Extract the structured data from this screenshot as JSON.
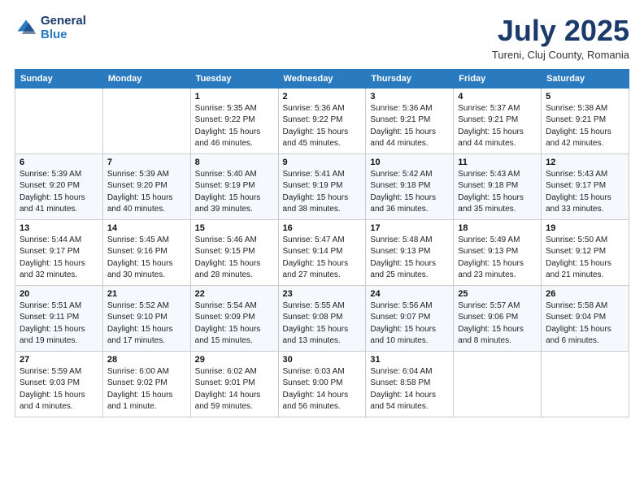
{
  "logo": {
    "general": "General",
    "blue": "Blue"
  },
  "title": "July 2025",
  "location": "Tureni, Cluj County, Romania",
  "headers": [
    "Sunday",
    "Monday",
    "Tuesday",
    "Wednesday",
    "Thursday",
    "Friday",
    "Saturday"
  ],
  "weeks": [
    [
      {
        "day": "",
        "info": ""
      },
      {
        "day": "",
        "info": ""
      },
      {
        "day": "1",
        "info": "Sunrise: 5:35 AM\nSunset: 9:22 PM\nDaylight: 15 hours\nand 46 minutes."
      },
      {
        "day": "2",
        "info": "Sunrise: 5:36 AM\nSunset: 9:22 PM\nDaylight: 15 hours\nand 45 minutes."
      },
      {
        "day": "3",
        "info": "Sunrise: 5:36 AM\nSunset: 9:21 PM\nDaylight: 15 hours\nand 44 minutes."
      },
      {
        "day": "4",
        "info": "Sunrise: 5:37 AM\nSunset: 9:21 PM\nDaylight: 15 hours\nand 44 minutes."
      },
      {
        "day": "5",
        "info": "Sunrise: 5:38 AM\nSunset: 9:21 PM\nDaylight: 15 hours\nand 42 minutes."
      }
    ],
    [
      {
        "day": "6",
        "info": "Sunrise: 5:39 AM\nSunset: 9:20 PM\nDaylight: 15 hours\nand 41 minutes."
      },
      {
        "day": "7",
        "info": "Sunrise: 5:39 AM\nSunset: 9:20 PM\nDaylight: 15 hours\nand 40 minutes."
      },
      {
        "day": "8",
        "info": "Sunrise: 5:40 AM\nSunset: 9:19 PM\nDaylight: 15 hours\nand 39 minutes."
      },
      {
        "day": "9",
        "info": "Sunrise: 5:41 AM\nSunset: 9:19 PM\nDaylight: 15 hours\nand 38 minutes."
      },
      {
        "day": "10",
        "info": "Sunrise: 5:42 AM\nSunset: 9:18 PM\nDaylight: 15 hours\nand 36 minutes."
      },
      {
        "day": "11",
        "info": "Sunrise: 5:43 AM\nSunset: 9:18 PM\nDaylight: 15 hours\nand 35 minutes."
      },
      {
        "day": "12",
        "info": "Sunrise: 5:43 AM\nSunset: 9:17 PM\nDaylight: 15 hours\nand 33 minutes."
      }
    ],
    [
      {
        "day": "13",
        "info": "Sunrise: 5:44 AM\nSunset: 9:17 PM\nDaylight: 15 hours\nand 32 minutes."
      },
      {
        "day": "14",
        "info": "Sunrise: 5:45 AM\nSunset: 9:16 PM\nDaylight: 15 hours\nand 30 minutes."
      },
      {
        "day": "15",
        "info": "Sunrise: 5:46 AM\nSunset: 9:15 PM\nDaylight: 15 hours\nand 28 minutes."
      },
      {
        "day": "16",
        "info": "Sunrise: 5:47 AM\nSunset: 9:14 PM\nDaylight: 15 hours\nand 27 minutes."
      },
      {
        "day": "17",
        "info": "Sunrise: 5:48 AM\nSunset: 9:13 PM\nDaylight: 15 hours\nand 25 minutes."
      },
      {
        "day": "18",
        "info": "Sunrise: 5:49 AM\nSunset: 9:13 PM\nDaylight: 15 hours\nand 23 minutes."
      },
      {
        "day": "19",
        "info": "Sunrise: 5:50 AM\nSunset: 9:12 PM\nDaylight: 15 hours\nand 21 minutes."
      }
    ],
    [
      {
        "day": "20",
        "info": "Sunrise: 5:51 AM\nSunset: 9:11 PM\nDaylight: 15 hours\nand 19 minutes."
      },
      {
        "day": "21",
        "info": "Sunrise: 5:52 AM\nSunset: 9:10 PM\nDaylight: 15 hours\nand 17 minutes."
      },
      {
        "day": "22",
        "info": "Sunrise: 5:54 AM\nSunset: 9:09 PM\nDaylight: 15 hours\nand 15 minutes."
      },
      {
        "day": "23",
        "info": "Sunrise: 5:55 AM\nSunset: 9:08 PM\nDaylight: 15 hours\nand 13 minutes."
      },
      {
        "day": "24",
        "info": "Sunrise: 5:56 AM\nSunset: 9:07 PM\nDaylight: 15 hours\nand 10 minutes."
      },
      {
        "day": "25",
        "info": "Sunrise: 5:57 AM\nSunset: 9:06 PM\nDaylight: 15 hours\nand 8 minutes."
      },
      {
        "day": "26",
        "info": "Sunrise: 5:58 AM\nSunset: 9:04 PM\nDaylight: 15 hours\nand 6 minutes."
      }
    ],
    [
      {
        "day": "27",
        "info": "Sunrise: 5:59 AM\nSunset: 9:03 PM\nDaylight: 15 hours\nand 4 minutes."
      },
      {
        "day": "28",
        "info": "Sunrise: 6:00 AM\nSunset: 9:02 PM\nDaylight: 15 hours\nand 1 minute."
      },
      {
        "day": "29",
        "info": "Sunrise: 6:02 AM\nSunset: 9:01 PM\nDaylight: 14 hours\nand 59 minutes."
      },
      {
        "day": "30",
        "info": "Sunrise: 6:03 AM\nSunset: 9:00 PM\nDaylight: 14 hours\nand 56 minutes."
      },
      {
        "day": "31",
        "info": "Sunrise: 6:04 AM\nSunset: 8:58 PM\nDaylight: 14 hours\nand 54 minutes."
      },
      {
        "day": "",
        "info": ""
      },
      {
        "day": "",
        "info": ""
      }
    ]
  ]
}
